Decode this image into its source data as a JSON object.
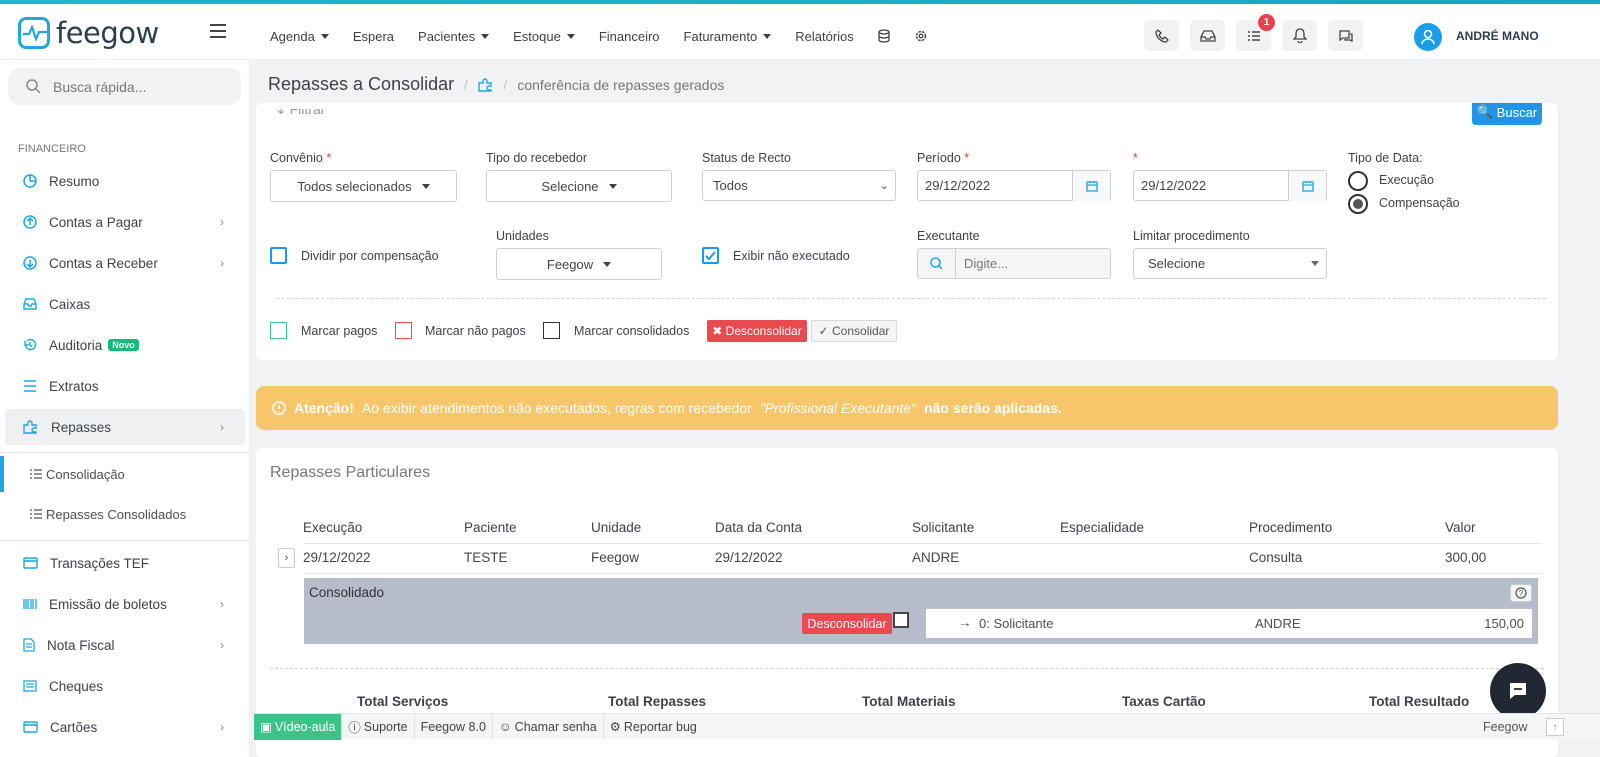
{
  "app": {
    "brand": "feegow",
    "accent": "#1fa6e5",
    "user": "ANDRÉ MANO",
    "notification_count": "1"
  },
  "nav": {
    "items": [
      {
        "label": "Agenda",
        "dropdown": true
      },
      {
        "label": "Espera",
        "dropdown": false
      },
      {
        "label": "Pacientes",
        "dropdown": true
      },
      {
        "label": "Estoque",
        "dropdown": true
      },
      {
        "label": "Financeiro",
        "dropdown": false
      },
      {
        "label": "Faturamento",
        "dropdown": true
      },
      {
        "label": "Relatórios",
        "dropdown": false
      }
    ]
  },
  "sidebar": {
    "search_placeholder": "Busca rápida...",
    "section": "FINANCEIRO",
    "items": [
      {
        "label": "Resumo",
        "icon": "pie-chart-icon",
        "chevron": false
      },
      {
        "label": "Contas a Pagar",
        "icon": "arrow-up-circle-icon",
        "chevron": true
      },
      {
        "label": "Contas a Receber",
        "icon": "arrow-down-circle-icon",
        "chevron": true
      },
      {
        "label": "Caixas",
        "icon": "inbox-icon",
        "chevron": false
      },
      {
        "label": "Auditoria",
        "icon": "history-icon",
        "chevron": false,
        "badge": "Novo"
      },
      {
        "label": "Extratos",
        "icon": "list-icon",
        "chevron": false
      },
      {
        "label": "Repasses",
        "icon": "puzzle-icon",
        "chevron": true
      }
    ],
    "sub_items": [
      {
        "label": "Consolidação"
      },
      {
        "label": "Repasses Consolidados"
      }
    ],
    "items_bottom": [
      {
        "label": "Transações TEF",
        "icon": "credit-card-icon",
        "chevron": false
      },
      {
        "label": "Emissão de boletos",
        "icon": "barcode-icon",
        "chevron": true
      },
      {
        "label": "Nota Fiscal",
        "icon": "document-icon",
        "chevron": true
      },
      {
        "label": "Cheques",
        "icon": "check-icon",
        "chevron": false
      },
      {
        "label": "Cartões",
        "icon": "card-icon",
        "chevron": true
      }
    ]
  },
  "breadcrumb": {
    "title": "Repasses a Consolidar",
    "sep": "/",
    "sub": "conferência de repasses gerados"
  },
  "filter": {
    "filtrar_label": "Filtrar",
    "buscar_label": "Buscar",
    "convenio_label": "Convênio",
    "convenio_value": "Todos selecionados",
    "tipo_recebedor_label": "Tipo do recebedor",
    "tipo_recebedor_value": "Selecione",
    "status_label": "Status de Recto",
    "status_value": "Todos",
    "periodo_label": "Período",
    "periodo_from": "29/12/2022",
    "periodo_to": "29/12/2022",
    "req_mark": "*",
    "tipo_data_label": "Tipo de Data:",
    "opt_execucao": "Execução",
    "opt_compensacao": "Compensação",
    "dividir_label": "Dividir por compensação",
    "unidades_label": "Unidades",
    "unidades_value": "Feegow",
    "exibir_label": "Exibir não executado",
    "executante_label": "Executante",
    "executante_placeholder": "Digite...",
    "limitar_label": "Limitar procedimento",
    "limitar_value": "Selecione",
    "marcar_pagos": "Marcar pagos",
    "marcar_nao_pagos": "Marcar não pagos",
    "marcar_consolidados": "Marcar consolidados",
    "desconsolidar": "Desconsolidar",
    "consolidar": "Consolidar"
  },
  "alert": {
    "strong": "Atenção!",
    "text1": "Ao exibir atendimentos não executados, regras com recebedor",
    "em": "\"Profissional Executante\"",
    "text2": "não serão aplicadas."
  },
  "list": {
    "title": "Repasses Particulares",
    "columns": [
      "Execução",
      "Paciente",
      "Unidade",
      "Data da Conta",
      "Solicitante",
      "Especialidade",
      "Procedimento",
      "Valor"
    ],
    "rows": [
      {
        "execucao": "29/12/2022",
        "paciente": "TESTE",
        "unidade": "Feegow",
        "data_conta": "29/12/2022",
        "solicitante": "ANDRE",
        "especialidade": "",
        "procedimento": "Consulta",
        "valor": "300,00"
      }
    ],
    "consolidado": {
      "title": "Consolidado",
      "help": "?",
      "button": "Desconsolidar",
      "arrow": "→",
      "item": "0: Solicitante",
      "name": "ANDRE",
      "valor": "150,00"
    },
    "totals": [
      "Total Serviços",
      "Total Repasses",
      "Total Materiais",
      "Taxas Cartão",
      "Total Resultado"
    ]
  },
  "footer": {
    "video": "Vídeo-aula",
    "suporte": "Suporte",
    "version": "Feegow 8.0",
    "chamar": "Chamar senha",
    "bug": "Reportar bug",
    "right": "Feegow"
  }
}
